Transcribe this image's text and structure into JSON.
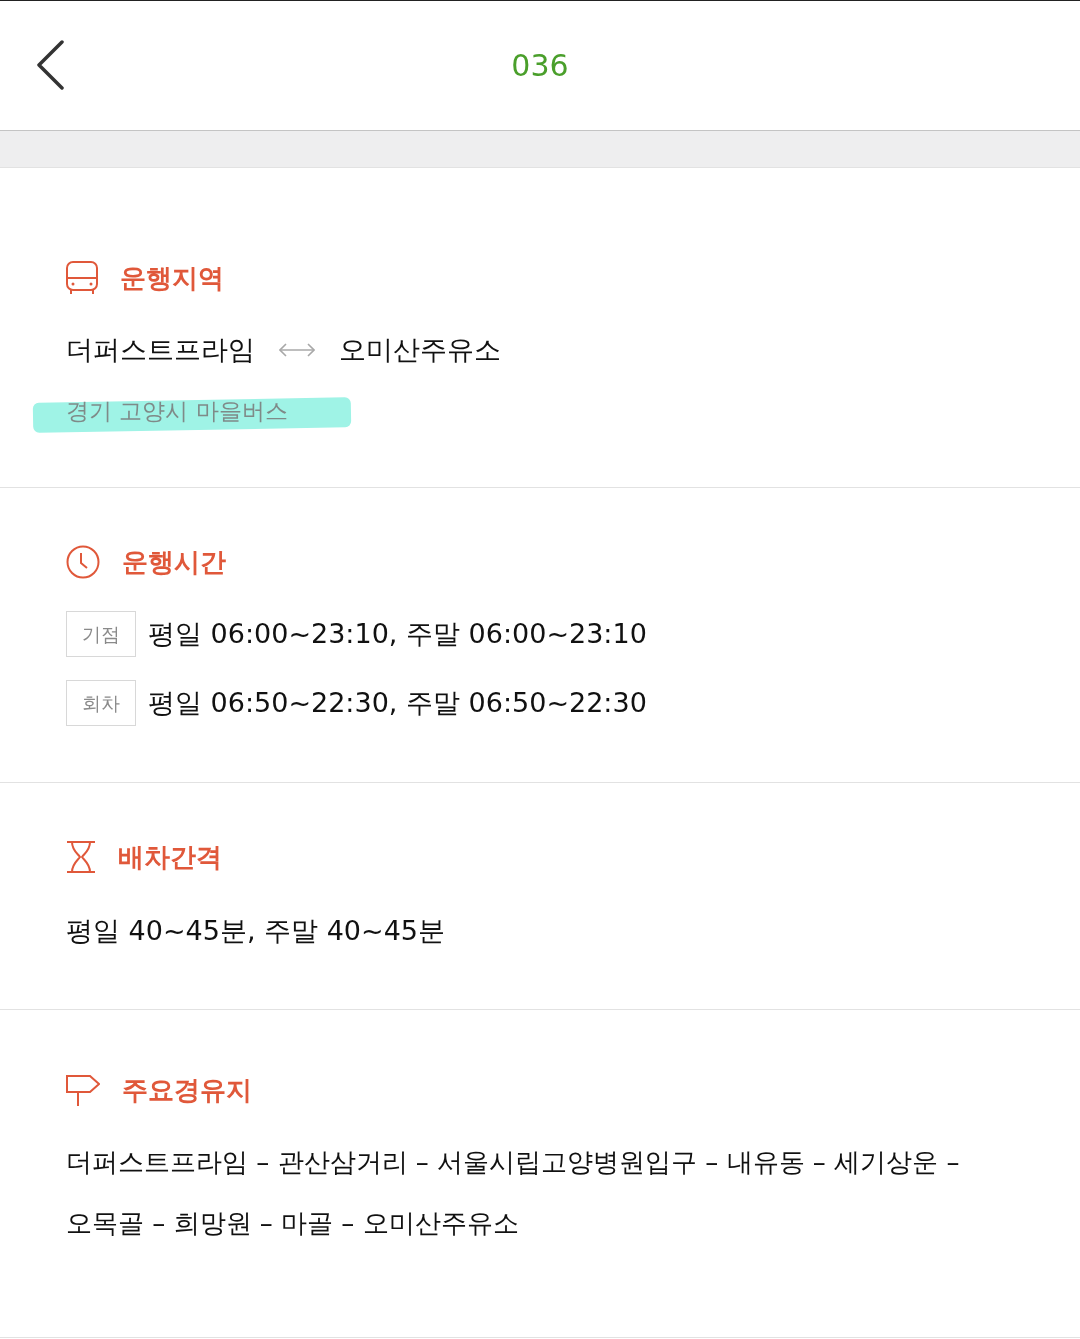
{
  "header": {
    "title": "036"
  },
  "sections": [
    {
      "kind": "region",
      "title": "운행지역",
      "start": "더퍼스트프라임",
      "end": "오미산주유소",
      "subtitle": "경기 고양시 마을버스",
      "highlighted": true
    },
    {
      "kind": "hours",
      "title": "운행시간",
      "rows": [
        {
          "badge": "기점",
          "text": "평일 06:00~23:10, 주말 06:00~23:10"
        },
        {
          "badge": "회차",
          "text": "평일 06:50~22:30, 주말 06:50~22:30"
        }
      ]
    },
    {
      "kind": "interval",
      "title": "배차간격",
      "text": "평일 40~45분, 주말 40~45분"
    },
    {
      "kind": "stops",
      "title": "주요경유지",
      "text": "더퍼스트프라임 – 관산삼거리 – 서울시립고양병원입구 – 내유동 – 세기상운 – 오목골 – 희망원 – 마골 – 오미산주유소"
    }
  ]
}
